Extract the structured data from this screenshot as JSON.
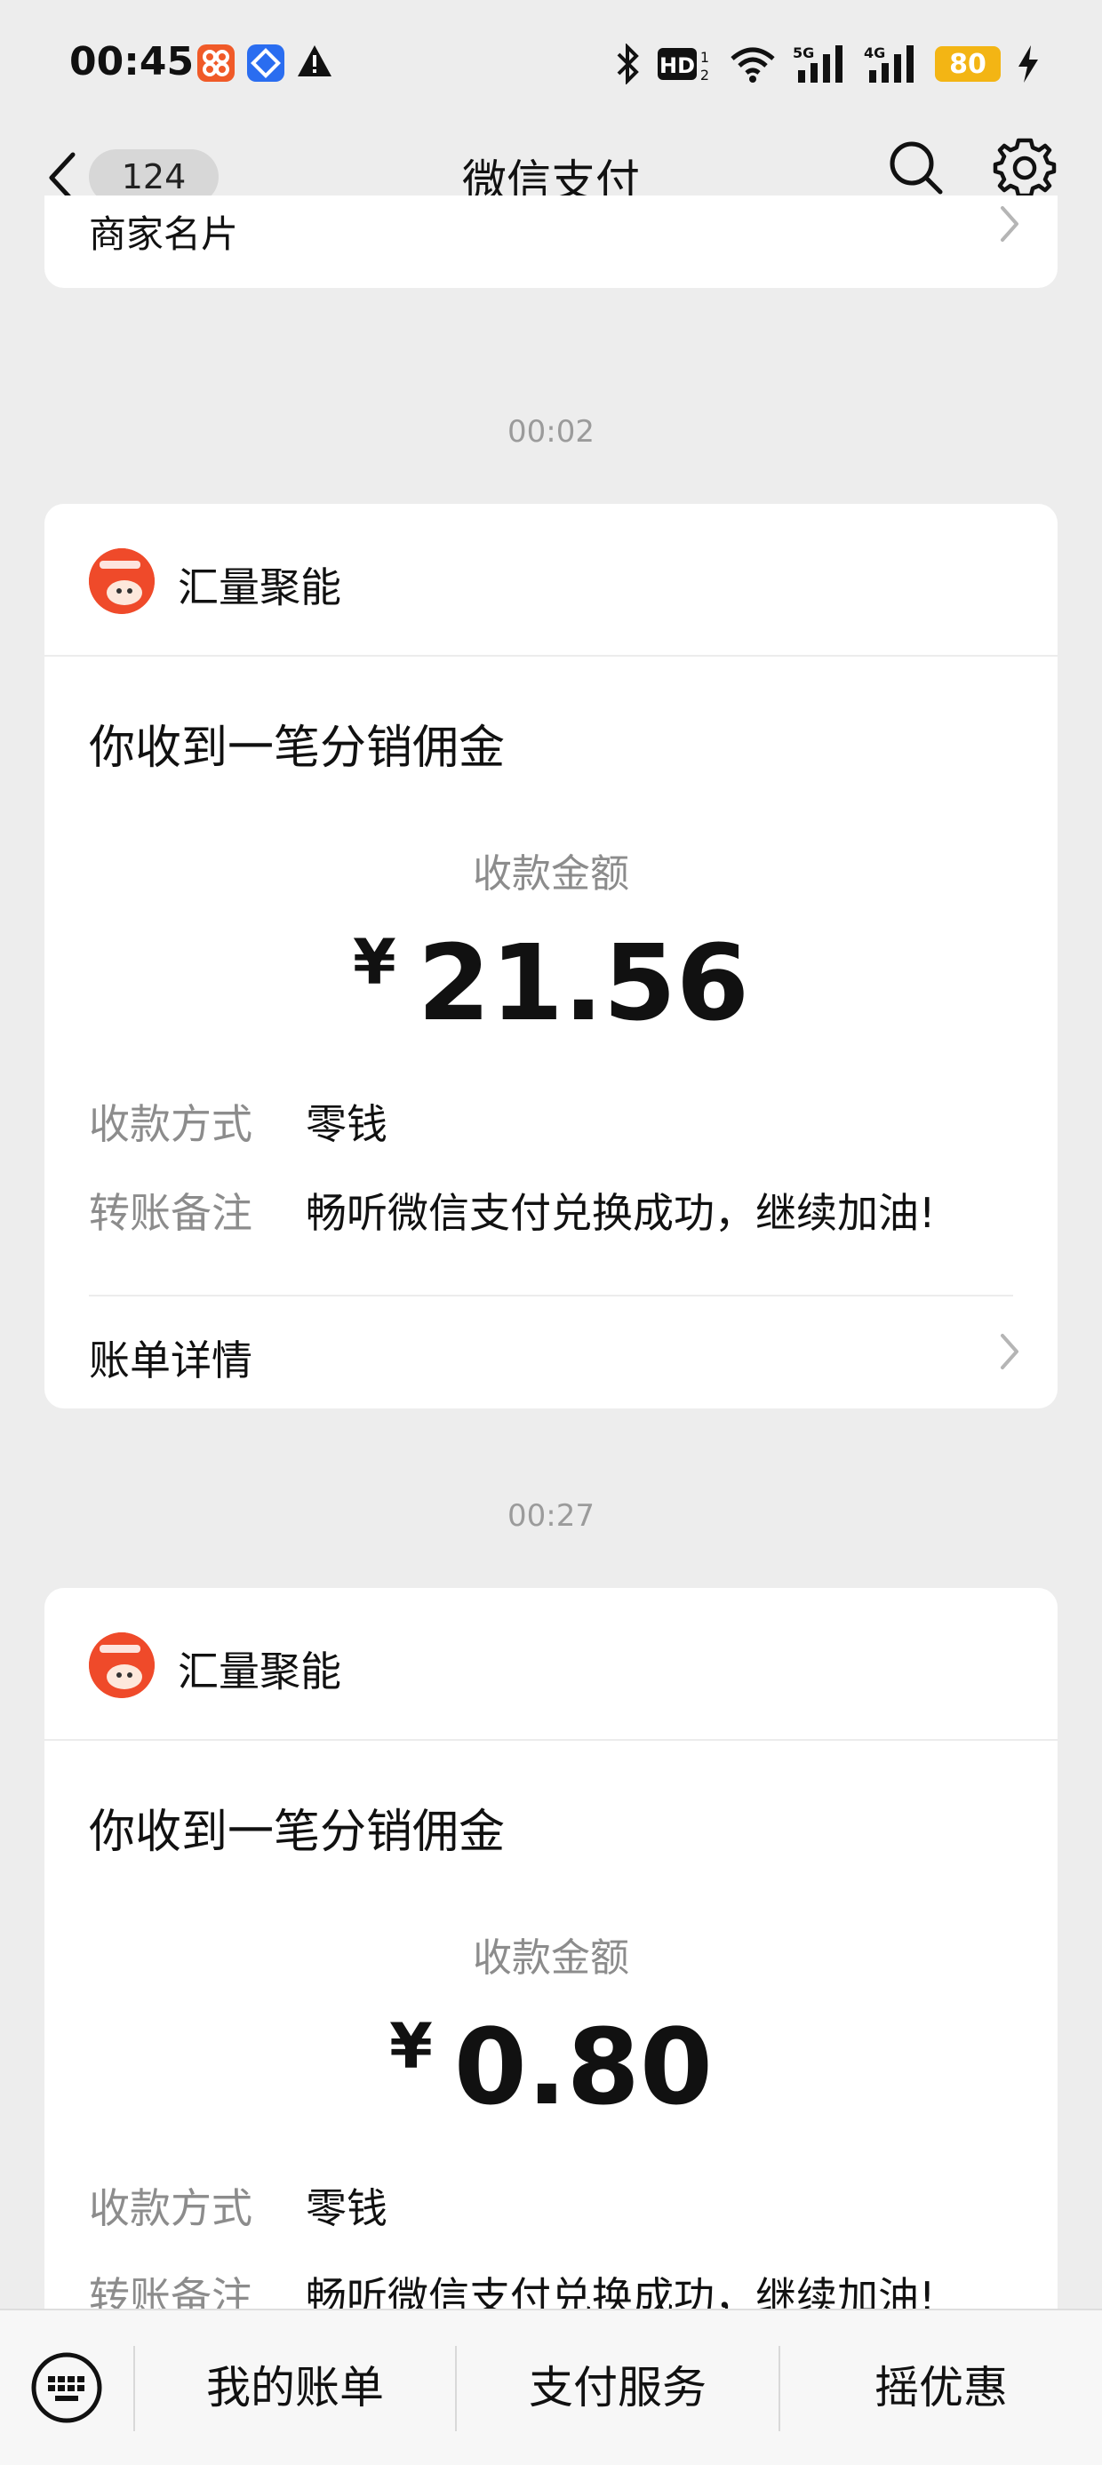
{
  "status_bar": {
    "time": "00:45",
    "battery": "80",
    "icons": [
      "app-icon-orange",
      "app-icon-blue",
      "warning-icon",
      "bluetooth-icon",
      "hd-icon",
      "wifi-icon",
      "5g-signal-icon",
      "4g-signal-icon",
      "battery-icon",
      "charging-icon"
    ]
  },
  "nav": {
    "back_count": "124",
    "title": "微信支付",
    "icons": [
      "back-chevron-icon",
      "search-icon",
      "gear-icon"
    ]
  },
  "merchant_card": {
    "label": "商家名片"
  },
  "messages": [
    {
      "time": "00:02",
      "merchant": "汇量聚能",
      "title": "你收到一笔分销佣金",
      "amount_label": "收款金额",
      "currency": "¥",
      "amount": "21.56",
      "rows": [
        {
          "label": "收款方式",
          "value": "零钱"
        },
        {
          "label": "转账备注",
          "value": "畅听微信支付兑换成功，继续加油!"
        }
      ],
      "detail_label": "账单详情"
    },
    {
      "time": "00:27",
      "merchant": "汇量聚能",
      "title": "你收到一笔分销佣金",
      "amount_label": "收款金额",
      "currency": "¥",
      "amount": "0.80",
      "rows": [
        {
          "label": "收款方式",
          "value": "零钱"
        },
        {
          "label": "转账备注",
          "value": "畅听微信支付兑换成功，继续加油!"
        }
      ]
    }
  ],
  "bottom_menu": {
    "keyboard_icon": "keyboard-icon",
    "items": [
      "我的账单",
      "支付服务",
      "摇优惠"
    ]
  },
  "colors": {
    "background": "#ededed",
    "card": "#ffffff",
    "secondary_text": "#8c8c8c",
    "avatar": "#ef4a2a",
    "battery": "#f3b514"
  }
}
